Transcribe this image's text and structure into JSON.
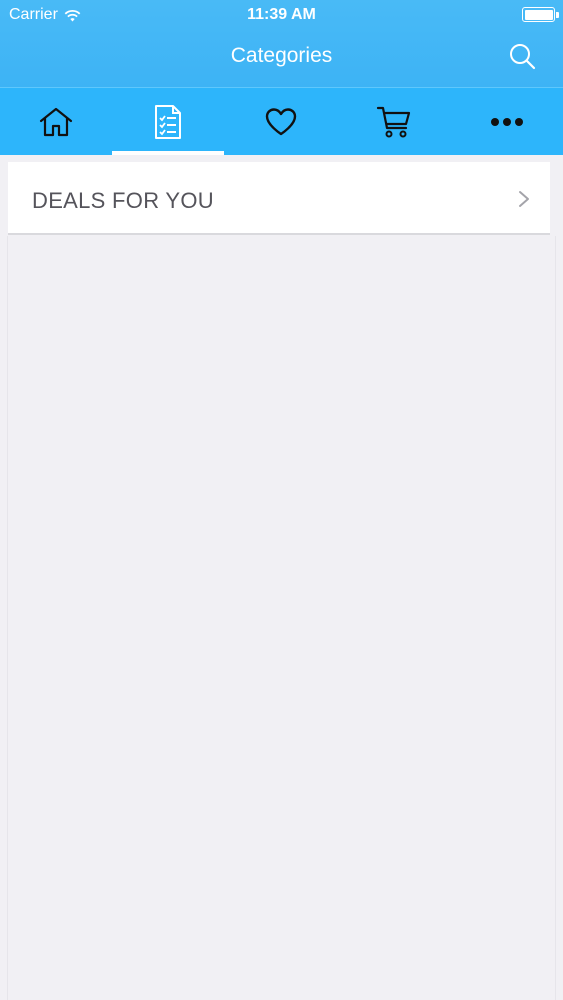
{
  "status_bar": {
    "carrier": "Carrier",
    "time": "11:39 AM",
    "battery_level": 1.0
  },
  "nav": {
    "title": "Categories",
    "search_icon": "search-icon"
  },
  "tabs": [
    {
      "name": "home",
      "icon": "home-icon",
      "active": false
    },
    {
      "name": "categories",
      "icon": "checklist-icon",
      "active": true
    },
    {
      "name": "favorites",
      "icon": "heart-icon",
      "active": false
    },
    {
      "name": "cart",
      "icon": "cart-icon",
      "active": false
    },
    {
      "name": "more",
      "icon": "more-icon",
      "active": false
    }
  ],
  "list": {
    "items": [
      {
        "label": "DEALS FOR YOU",
        "icon": "chevron-right-icon"
      }
    ]
  },
  "colors": {
    "nav_bar": "#3db3f5",
    "tab_bar": "#2db5fb",
    "background": "#f1f0f4"
  }
}
